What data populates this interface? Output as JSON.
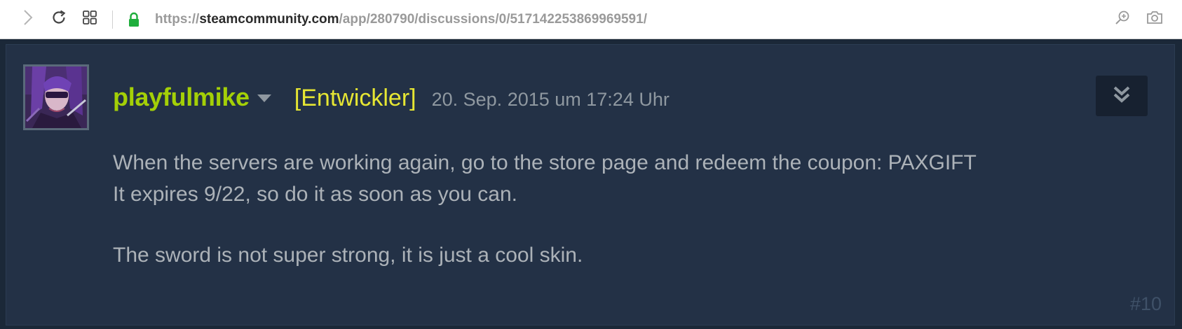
{
  "browser": {
    "url_scheme": "https://",
    "url_host": "steamcommunity.com",
    "url_path": "/app/280790/discussions/0/517142253869969591/"
  },
  "post": {
    "author": "playfulmike",
    "role_badge": "[Entwickler]",
    "timestamp": "20. Sep. 2015 um 17:24 Uhr",
    "body_lines": [
      "When the servers are working again, go to the store page and redeem the coupon: PAXGIFT",
      "It expires 9/22, so do it as soon as you can.",
      "The sword is not super strong, it is just a cool skin."
    ],
    "post_number": "#10"
  },
  "colors": {
    "author": "#a4d007",
    "badge": "#e6e633",
    "body_text": "#acb2b8",
    "post_bg": "#233146",
    "page_bg": "#1b2838"
  },
  "icons": {
    "forward": "chevron-right-icon",
    "reload": "reload-icon",
    "tabs": "grid-icon",
    "secure": "lock-icon",
    "zoom": "zoom-in-icon",
    "screenshot": "camera-icon",
    "author_menu": "caret-down-icon",
    "collapse": "double-chevron-down-icon"
  }
}
